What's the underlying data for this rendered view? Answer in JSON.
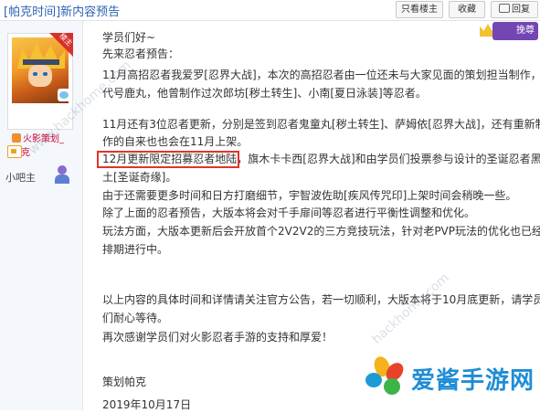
{
  "header": {
    "title": "[帕克时间]新内容预告",
    "buttons": {
      "only_op": "只看楼主",
      "favorite": "收藏",
      "reply": "回复"
    }
  },
  "author": {
    "corner_label": "楼主",
    "name": "火影策划_帕克",
    "role": "小吧主"
  },
  "post_badge": {
    "label": "挽尊"
  },
  "post": {
    "lines": [
      "学员们好~",
      "先来忍者预告：",
      "11月高招忍者我爱罗[忍界大战]，本次的高招忍者由一位还未与大家见面的策划担当制作，",
      "代号鹿丸，他曾制作过次郎坊[秽土转生]、小南[夏日泳装]等忍者。",
      "11月还有3位忍者更新，分别是签到忍者鬼童丸[秽土转生]、萨姆依[忍界大战]，还有重新制",
      "作的自来也也会在11月上架。",
      "12月更新限定招募忍者地陆，旗木卡卡西[忍界大战]和由学员们投票参与设计的圣诞忍者黑",
      "土[圣诞奇缘]。",
      "由于还需要更多时间和日方打磨细节，宇智波佐助[疾风传咒印]上架时间会稍晚一些。",
      "除了上面的忍者预告，大版本将会对千手扉间等忍者进行平衡性调整和优化。",
      "玩法方面，大版本更新后会开放首个2V2V2的三方竞技玩法，针对老PVP玩法的优化也已经",
      "排期进行中。",
      "以上内容的具体时间和详情请关注官方公告，若一切顺利，大版本将于10月底更新，请学员",
      "们耐心等待。",
      "再次感谢学员们对火影忍者手游的支持和厚爱！",
      "策划帕克",
      "2019年10月17日"
    ]
  },
  "watermarks": [
    "www.hackhome.com",
    "hackhome.com"
  ],
  "logo": {
    "text": "爱酱手游网"
  },
  "colors": {
    "title_blue": "#2d64b3",
    "highlight_red": "#e0342c",
    "logo_blue": "#1f8dd6"
  }
}
